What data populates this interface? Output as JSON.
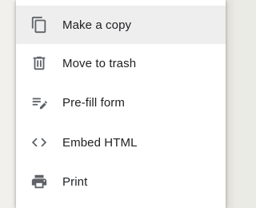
{
  "menu": {
    "items": [
      {
        "label": "Make a copy",
        "icon": "copy-icon",
        "highlighted": true
      },
      {
        "label": "Move to trash",
        "icon": "trash-icon",
        "highlighted": false
      },
      {
        "label": "Pre-fill form",
        "icon": "prefill-edit-icon",
        "highlighted": false
      },
      {
        "label": "Embed HTML",
        "icon": "code-brackets-icon",
        "highlighted": false
      },
      {
        "label": "Print",
        "icon": "print-icon",
        "highlighted": false
      }
    ]
  },
  "colors": {
    "icon": "#5f6368",
    "text": "#202124",
    "highlight": "#eeeeee",
    "page_background": "#ebebe6",
    "menu_background": "#ffffff"
  }
}
